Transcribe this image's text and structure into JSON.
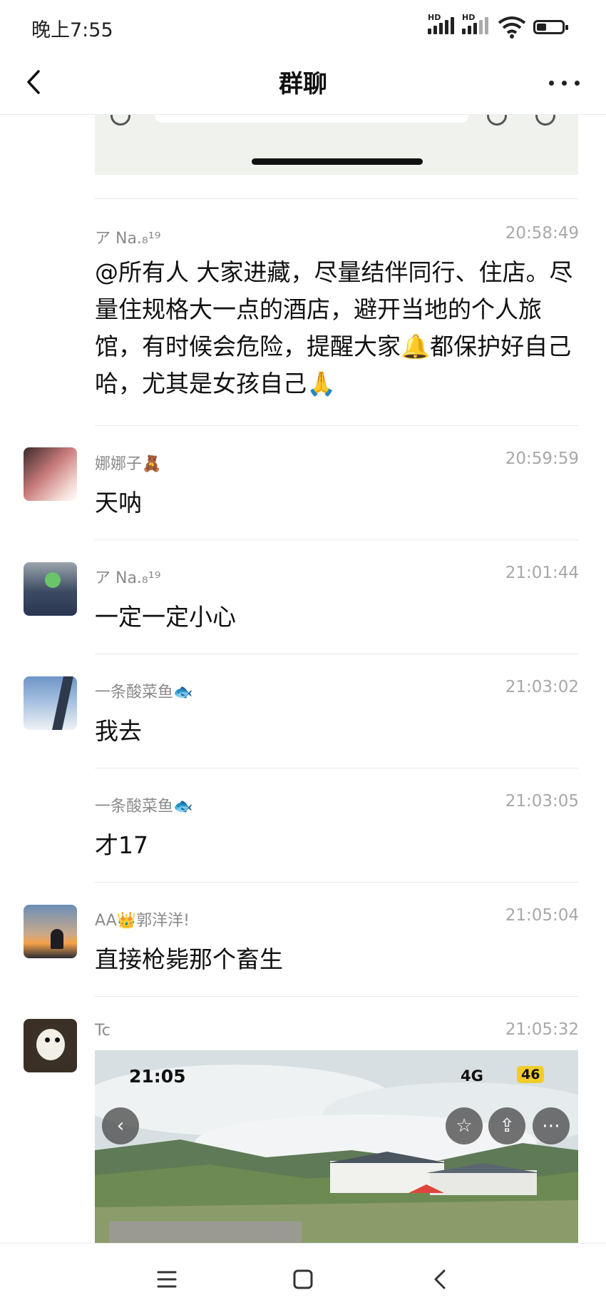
{
  "status_bar": {
    "time": "晚上7:55",
    "hd_label": "HD"
  },
  "nav": {
    "title": "群聊"
  },
  "messages": [
    {
      "sender": "ア Na.₈¹⁹",
      "time": "20:58:49",
      "text": "@所有人 大家进藏，尽量结伴同行、住店。尽量住规格大一点的酒店，避开当地的个人旅馆，有时候会危险，提醒大家🔔都保护好自己哈，尤其是女孩自己🙏"
    },
    {
      "sender": "娜娜子🧸",
      "time": "20:59:59",
      "text": "天呐"
    },
    {
      "sender": "ア Na.₈¹⁹",
      "time": "21:01:44",
      "text": "一定一定小心"
    },
    {
      "sender": "一条酸菜鱼🐟",
      "time": "21:03:02",
      "text": "我去"
    },
    {
      "sender": "一条酸菜鱼🐟",
      "time": "21:03:05",
      "text": "才17"
    },
    {
      "sender": "AA👑郭洋洋!",
      "time": "21:05:04",
      "text": "直接枪毙那个畜生"
    },
    {
      "sender": "Tc",
      "time": "21:05:32",
      "text": ""
    }
  ],
  "photo": {
    "time": "21:05",
    "network": "4G",
    "badge": "46"
  },
  "colors": {
    "text": "#111111",
    "meta": "#8a8a8a",
    "divider": "#e8e8e8"
  }
}
